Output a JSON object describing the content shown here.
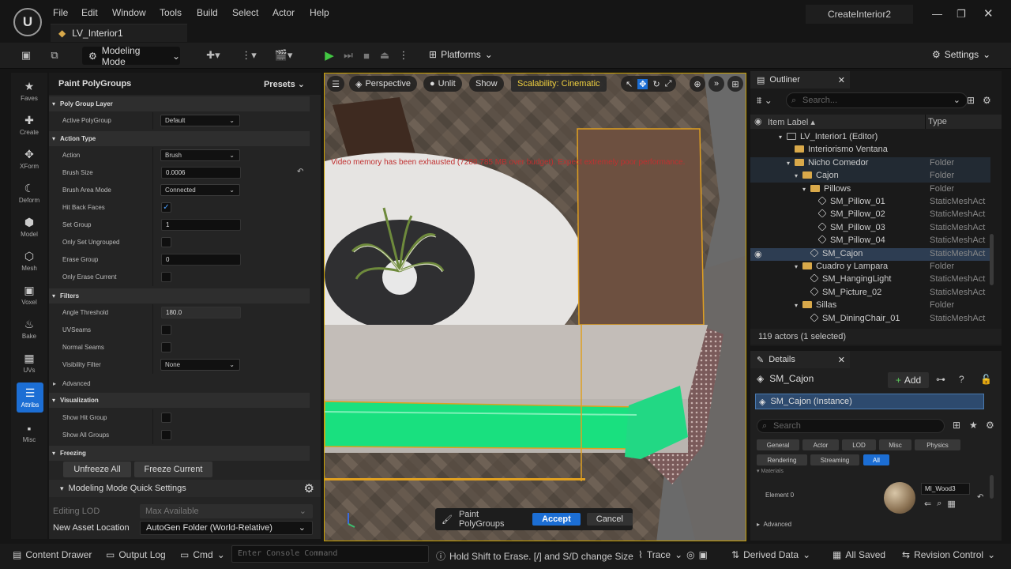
{
  "app": {
    "project": "CreateInterior2",
    "level_tab": "LV_Interior1"
  },
  "menu": [
    "File",
    "Edit",
    "Window",
    "Tools",
    "Build",
    "Select",
    "Actor",
    "Help"
  ],
  "toolbar": {
    "mode_label": "Modeling Mode",
    "platforms_label": "Platforms",
    "settings_label": "Settings"
  },
  "rail": [
    {
      "label": "Faves",
      "icon": "★"
    },
    {
      "label": "Create",
      "icon": "✚"
    },
    {
      "label": "XForm",
      "icon": "✥"
    },
    {
      "label": "Deform",
      "icon": "☾"
    },
    {
      "label": "Model",
      "icon": "⬢"
    },
    {
      "label": "Mesh",
      "icon": "⬡"
    },
    {
      "label": "Voxel",
      "icon": "▣"
    },
    {
      "label": "Bake",
      "icon": "♨"
    },
    {
      "label": "UVs",
      "icon": "▦"
    },
    {
      "label": "Attribs",
      "icon": "☰"
    },
    {
      "label": "Misc",
      "icon": "▪"
    }
  ],
  "tool": {
    "title": "Paint PolyGroups",
    "presets": "Presets",
    "sections": {
      "poly_group_layer": "Poly Group Layer",
      "action_type": "Action Type",
      "filters": "Filters",
      "advanced": "Advanced",
      "visualization": "Visualization",
      "freezing": "Freezing"
    },
    "props": {
      "active_polygroup": {
        "label": "Active PolyGroup",
        "value": "Default"
      },
      "action": {
        "label": "Action",
        "value": "Brush"
      },
      "brush_size": {
        "label": "Brush Size",
        "value": "0.0006"
      },
      "brush_area_mode": {
        "label": "Brush Area Mode",
        "value": "Connected"
      },
      "hit_back_faces": {
        "label": "Hit Back Faces",
        "checked": true
      },
      "set_group": {
        "label": "Set Group",
        "value": "1"
      },
      "only_set_ungrouped": {
        "label": "Only Set Ungrouped",
        "checked": false
      },
      "erase_group": {
        "label": "Erase Group",
        "value": "0"
      },
      "only_erase_current": {
        "label": "Only Erase Current",
        "checked": false
      },
      "angle_threshold": {
        "label": "Angle Threshold",
        "value": "180.0"
      },
      "uv_seams": {
        "label": "UVSeams",
        "checked": false
      },
      "normal_seams": {
        "label": "Normal Seams",
        "checked": false
      },
      "visibility_filter": {
        "label": "Visibility Filter",
        "value": "None"
      },
      "show_hit_group": {
        "label": "Show Hit Group",
        "checked": false
      },
      "show_all_groups": {
        "label": "Show All Groups",
        "checked": false
      }
    },
    "unfreeze_all": "Unfreeze All",
    "freeze_current": "Freeze Current",
    "quick_settings": "Modeling Mode Quick Settings",
    "editing_lod": {
      "label": "Editing LOD",
      "value": "Max Available"
    },
    "new_asset_location": {
      "label": "New Asset Location",
      "value": "AutoGen Folder (World-Relative)"
    }
  },
  "viewport": {
    "perspective": "Perspective",
    "unlit": "Unlit",
    "show": "Show",
    "scalability": "Scalability: Cinematic",
    "warning": "Video memory has been exhausted (7288.785 MB over budget). Expect extremely poor performance.",
    "tool_name": "Paint PolyGroups",
    "accept": "Accept",
    "cancel": "Cancel",
    "colors": {
      "selection": "#19e07f",
      "outline": "#e0a020"
    }
  },
  "outliner": {
    "title": "Outliner",
    "search_placeholder": "Search...",
    "col_label": "Item Label",
    "col_type": "Type",
    "rows": [
      {
        "name": "LV_Interior1 (Editor)",
        "type": "",
        "depth": 0,
        "kind": "level"
      },
      {
        "name": "Interiorismo Ventana",
        "type": "",
        "depth": 1,
        "kind": "folder"
      },
      {
        "name": "Nicho Comedor",
        "type": "Folder",
        "depth": 1,
        "kind": "folder"
      },
      {
        "name": "Cajon",
        "type": "Folder",
        "depth": 2,
        "kind": "folder"
      },
      {
        "name": "Pillows",
        "type": "Folder",
        "depth": 3,
        "kind": "folder"
      },
      {
        "name": "SM_Pillow_01",
        "type": "StaticMeshAct",
        "depth": 4,
        "kind": "mesh"
      },
      {
        "name": "SM_Pillow_02",
        "type": "StaticMeshAct",
        "depth": 4,
        "kind": "mesh"
      },
      {
        "name": "SM_Pillow_03",
        "type": "StaticMeshAct",
        "depth": 4,
        "kind": "mesh"
      },
      {
        "name": "SM_Pillow_04",
        "type": "StaticMeshAct",
        "depth": 4,
        "kind": "mesh"
      },
      {
        "name": "SM_Cajon",
        "type": "StaticMeshAct",
        "depth": 3,
        "kind": "mesh",
        "selected": true
      },
      {
        "name": "Cuadro y Lampara",
        "type": "Folder",
        "depth": 2,
        "kind": "folder"
      },
      {
        "name": "SM_HangingLight",
        "type": "StaticMeshAct",
        "depth": 3,
        "kind": "mesh"
      },
      {
        "name": "SM_Picture_02",
        "type": "StaticMeshAct",
        "depth": 3,
        "kind": "mesh"
      },
      {
        "name": "Sillas",
        "type": "Folder",
        "depth": 2,
        "kind": "folder"
      },
      {
        "name": "SM_DiningChair_01",
        "type": "StaticMeshAct",
        "depth": 3,
        "kind": "mesh"
      }
    ],
    "footer": "119 actors (1 selected)"
  },
  "details": {
    "title": "Details",
    "object": "SM_Cajon",
    "add": "Add",
    "instance": "SM_Cajon (Instance)",
    "search_placeholder": "Search",
    "filters": [
      "General",
      "Actor",
      "LOD",
      "Misc",
      "Physics",
      "Rendering",
      "Streaming",
      "All"
    ],
    "materials_header": "Materials",
    "element": "Element 0",
    "material": "MI_Wood3",
    "advanced": "Advanced"
  },
  "status": {
    "content_drawer": "Content Drawer",
    "output_log": "Output Log",
    "cmd": "Cmd",
    "console_placeholder": "Enter Console Command",
    "hint": "Hold Shift to Erase. [/] and S/D change Size",
    "trace": "Trace",
    "derived_data": "Derived Data",
    "all_saved": "All Saved",
    "revision_control": "Revision Control"
  }
}
